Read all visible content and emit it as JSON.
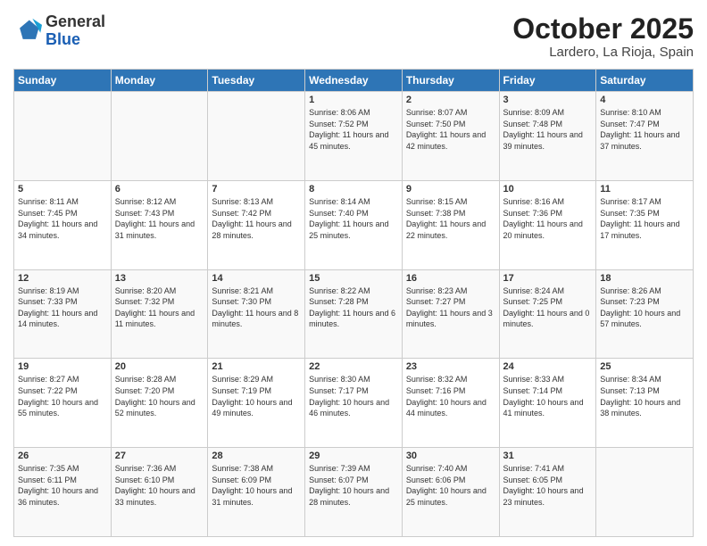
{
  "header": {
    "logo_line1": "General",
    "logo_line2": "Blue",
    "month": "October 2025",
    "location": "Lardero, La Rioja, Spain"
  },
  "weekdays": [
    "Sunday",
    "Monday",
    "Tuesday",
    "Wednesday",
    "Thursday",
    "Friday",
    "Saturday"
  ],
  "weeks": [
    [
      {
        "day": "",
        "info": ""
      },
      {
        "day": "",
        "info": ""
      },
      {
        "day": "",
        "info": ""
      },
      {
        "day": "1",
        "info": "Sunrise: 8:06 AM\nSunset: 7:52 PM\nDaylight: 11 hours and 45 minutes."
      },
      {
        "day": "2",
        "info": "Sunrise: 8:07 AM\nSunset: 7:50 PM\nDaylight: 11 hours and 42 minutes."
      },
      {
        "day": "3",
        "info": "Sunrise: 8:09 AM\nSunset: 7:48 PM\nDaylight: 11 hours and 39 minutes."
      },
      {
        "day": "4",
        "info": "Sunrise: 8:10 AM\nSunset: 7:47 PM\nDaylight: 11 hours and 37 minutes."
      }
    ],
    [
      {
        "day": "5",
        "info": "Sunrise: 8:11 AM\nSunset: 7:45 PM\nDaylight: 11 hours and 34 minutes."
      },
      {
        "day": "6",
        "info": "Sunrise: 8:12 AM\nSunset: 7:43 PM\nDaylight: 11 hours and 31 minutes."
      },
      {
        "day": "7",
        "info": "Sunrise: 8:13 AM\nSunset: 7:42 PM\nDaylight: 11 hours and 28 minutes."
      },
      {
        "day": "8",
        "info": "Sunrise: 8:14 AM\nSunset: 7:40 PM\nDaylight: 11 hours and 25 minutes."
      },
      {
        "day": "9",
        "info": "Sunrise: 8:15 AM\nSunset: 7:38 PM\nDaylight: 11 hours and 22 minutes."
      },
      {
        "day": "10",
        "info": "Sunrise: 8:16 AM\nSunset: 7:36 PM\nDaylight: 11 hours and 20 minutes."
      },
      {
        "day": "11",
        "info": "Sunrise: 8:17 AM\nSunset: 7:35 PM\nDaylight: 11 hours and 17 minutes."
      }
    ],
    [
      {
        "day": "12",
        "info": "Sunrise: 8:19 AM\nSunset: 7:33 PM\nDaylight: 11 hours and 14 minutes."
      },
      {
        "day": "13",
        "info": "Sunrise: 8:20 AM\nSunset: 7:32 PM\nDaylight: 11 hours and 11 minutes."
      },
      {
        "day": "14",
        "info": "Sunrise: 8:21 AM\nSunset: 7:30 PM\nDaylight: 11 hours and 8 minutes."
      },
      {
        "day": "15",
        "info": "Sunrise: 8:22 AM\nSunset: 7:28 PM\nDaylight: 11 hours and 6 minutes."
      },
      {
        "day": "16",
        "info": "Sunrise: 8:23 AM\nSunset: 7:27 PM\nDaylight: 11 hours and 3 minutes."
      },
      {
        "day": "17",
        "info": "Sunrise: 8:24 AM\nSunset: 7:25 PM\nDaylight: 11 hours and 0 minutes."
      },
      {
        "day": "18",
        "info": "Sunrise: 8:26 AM\nSunset: 7:23 PM\nDaylight: 10 hours and 57 minutes."
      }
    ],
    [
      {
        "day": "19",
        "info": "Sunrise: 8:27 AM\nSunset: 7:22 PM\nDaylight: 10 hours and 55 minutes."
      },
      {
        "day": "20",
        "info": "Sunrise: 8:28 AM\nSunset: 7:20 PM\nDaylight: 10 hours and 52 minutes."
      },
      {
        "day": "21",
        "info": "Sunrise: 8:29 AM\nSunset: 7:19 PM\nDaylight: 10 hours and 49 minutes."
      },
      {
        "day": "22",
        "info": "Sunrise: 8:30 AM\nSunset: 7:17 PM\nDaylight: 10 hours and 46 minutes."
      },
      {
        "day": "23",
        "info": "Sunrise: 8:32 AM\nSunset: 7:16 PM\nDaylight: 10 hours and 44 minutes."
      },
      {
        "day": "24",
        "info": "Sunrise: 8:33 AM\nSunset: 7:14 PM\nDaylight: 10 hours and 41 minutes."
      },
      {
        "day": "25",
        "info": "Sunrise: 8:34 AM\nSunset: 7:13 PM\nDaylight: 10 hours and 38 minutes."
      }
    ],
    [
      {
        "day": "26",
        "info": "Sunrise: 7:35 AM\nSunset: 6:11 PM\nDaylight: 10 hours and 36 minutes."
      },
      {
        "day": "27",
        "info": "Sunrise: 7:36 AM\nSunset: 6:10 PM\nDaylight: 10 hours and 33 minutes."
      },
      {
        "day": "28",
        "info": "Sunrise: 7:38 AM\nSunset: 6:09 PM\nDaylight: 10 hours and 31 minutes."
      },
      {
        "day": "29",
        "info": "Sunrise: 7:39 AM\nSunset: 6:07 PM\nDaylight: 10 hours and 28 minutes."
      },
      {
        "day": "30",
        "info": "Sunrise: 7:40 AM\nSunset: 6:06 PM\nDaylight: 10 hours and 25 minutes."
      },
      {
        "day": "31",
        "info": "Sunrise: 7:41 AM\nSunset: 6:05 PM\nDaylight: 10 hours and 23 minutes."
      },
      {
        "day": "",
        "info": ""
      }
    ]
  ]
}
